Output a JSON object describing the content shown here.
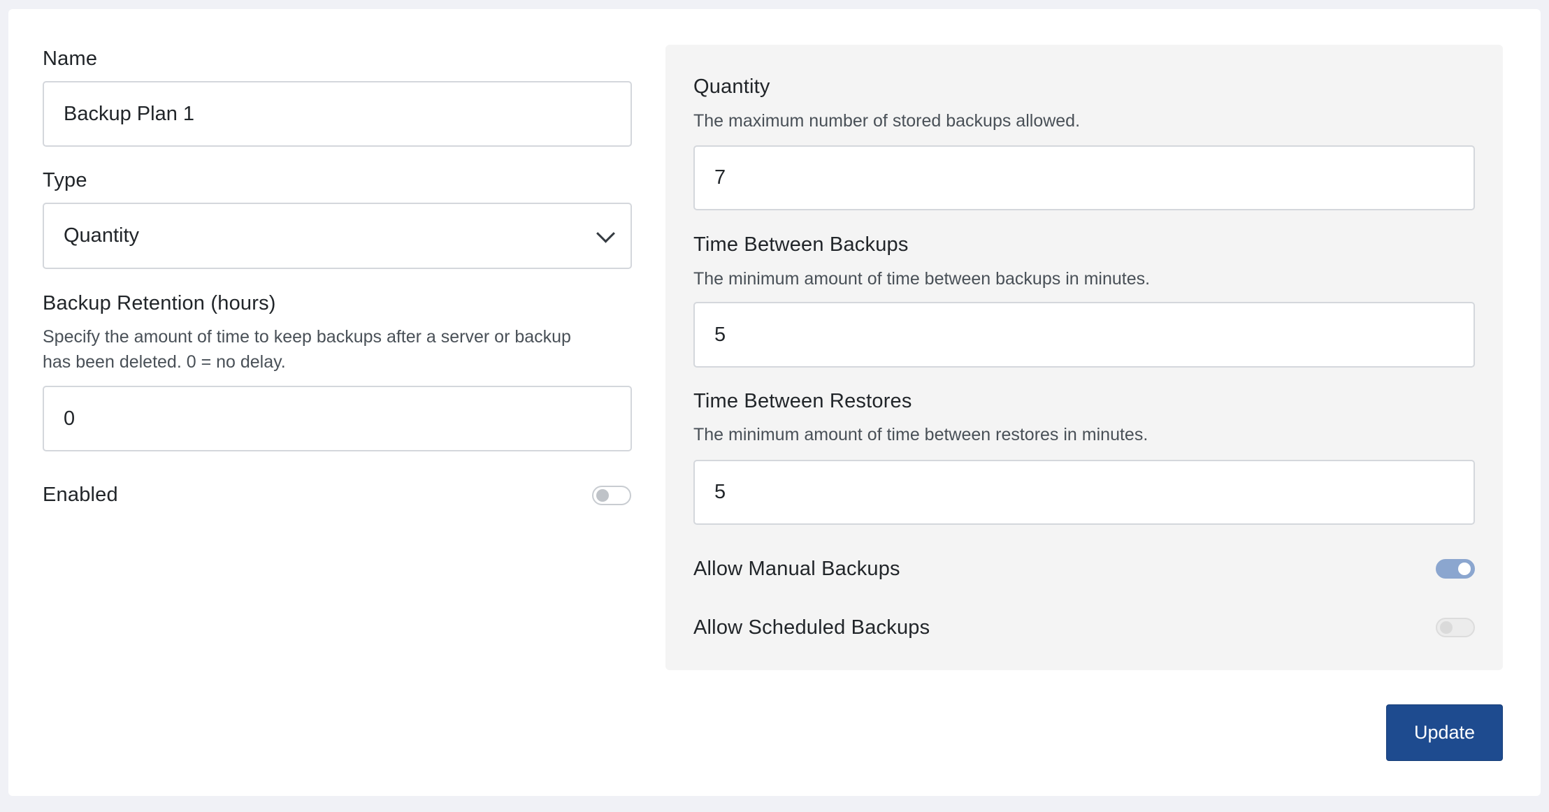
{
  "left": {
    "name": {
      "label": "Name",
      "value": "Backup Plan 1"
    },
    "type": {
      "label": "Type",
      "value": "Quantity"
    },
    "retention": {
      "label": "Backup Retention (hours)",
      "help_line1": "Specify the amount of time to keep backups after a server or backup",
      "help_line2": "has been deleted. 0 = no delay.",
      "value": "0"
    },
    "enabled": {
      "label": "Enabled",
      "state": false
    }
  },
  "right": {
    "quantity": {
      "label": "Quantity",
      "help": "The maximum number of stored backups allowed.",
      "value": "7"
    },
    "time_between_backups": {
      "label": "Time Between Backups",
      "help": "The minimum amount of time between backups in minutes.",
      "value": "5"
    },
    "time_between_restores": {
      "label": "Time Between Restores",
      "help": "The minimum amount of time between restores in minutes.",
      "value": "5"
    },
    "allow_manual": {
      "label": "Allow Manual Backups",
      "state": true
    },
    "allow_scheduled": {
      "label": "Allow Scheduled Backups",
      "state": false
    }
  },
  "actions": {
    "update_label": "Update"
  },
  "colors": {
    "primary": "#1e4b8f",
    "toggle_on": "#8ba6cf",
    "panel_bg": "#f4f4f4",
    "page_bg": "#f0f1f6"
  },
  "icons": {
    "select": "chevron-down-icon"
  }
}
